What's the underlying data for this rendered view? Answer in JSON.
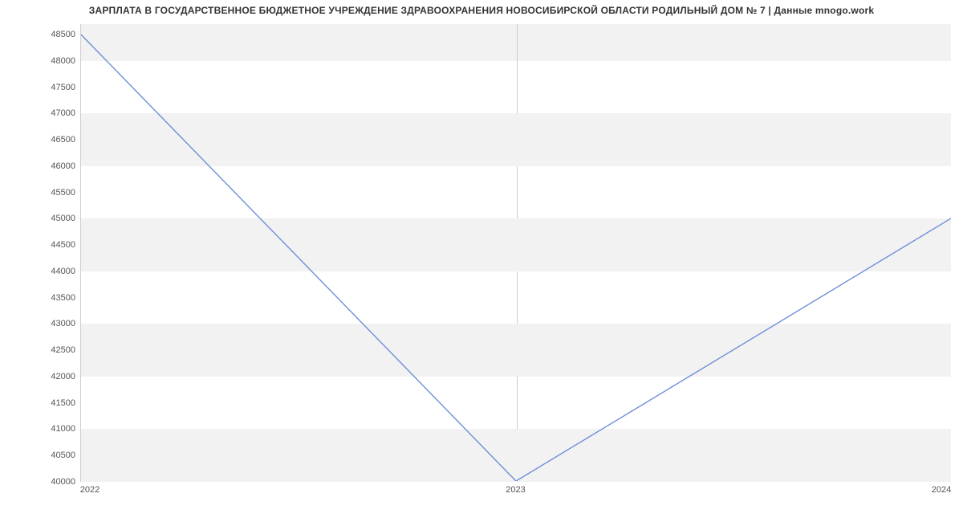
{
  "chart_data": {
    "type": "line",
    "title": "ЗАРПЛАТА В ГОСУДАРСТВЕННОЕ БЮДЖЕТНОЕ УЧРЕЖДЕНИЕ ЗДРАВООХРАНЕНИЯ НОВОСИБИРСКОЙ ОБЛАСТИ РОДИЛЬНЫЙ ДОМ № 7 | Данные mnogo.work",
    "x": [
      2022,
      2023,
      2024
    ],
    "values": [
      48500,
      40000,
      45000
    ],
    "x_ticks": [
      2022,
      2023,
      2024
    ],
    "y_ticks": [
      40000,
      40500,
      41000,
      41500,
      42000,
      42500,
      43000,
      43500,
      44000,
      44500,
      45000,
      45500,
      46000,
      46500,
      47000,
      47500,
      48000,
      48500
    ],
    "xlim": [
      2022,
      2024
    ],
    "ylim": [
      40000,
      48700
    ],
    "line_color": "#6e8fd9",
    "band_color": "#f2f2f2"
  }
}
